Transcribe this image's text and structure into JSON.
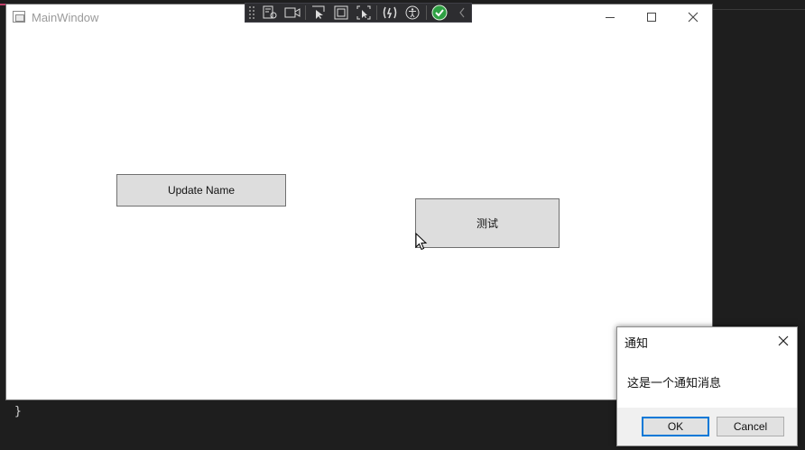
{
  "main_window": {
    "title": "MainWindow",
    "buttons": {
      "update_name": "Update Name",
      "test": "测试"
    }
  },
  "ide": {
    "brace": "}"
  },
  "debug_toolbar": {
    "icons": [
      "select-element-icon",
      "video-icon",
      "pointer-select-icon",
      "adorner-icon",
      "track-focus-icon",
      "hot-reload-icon",
      "accessibility-icon",
      "check-icon",
      "collapse-chevron-icon"
    ],
    "accent_color": "#2ea043"
  },
  "dialog": {
    "title": "通知",
    "message": "这是一个通知消息",
    "ok_label": "OK",
    "cancel_label": "Cancel"
  },
  "colors": {
    "ide_background": "#1e1e1e",
    "button_face": "#dddddd",
    "focus_border": "#0078d7"
  }
}
